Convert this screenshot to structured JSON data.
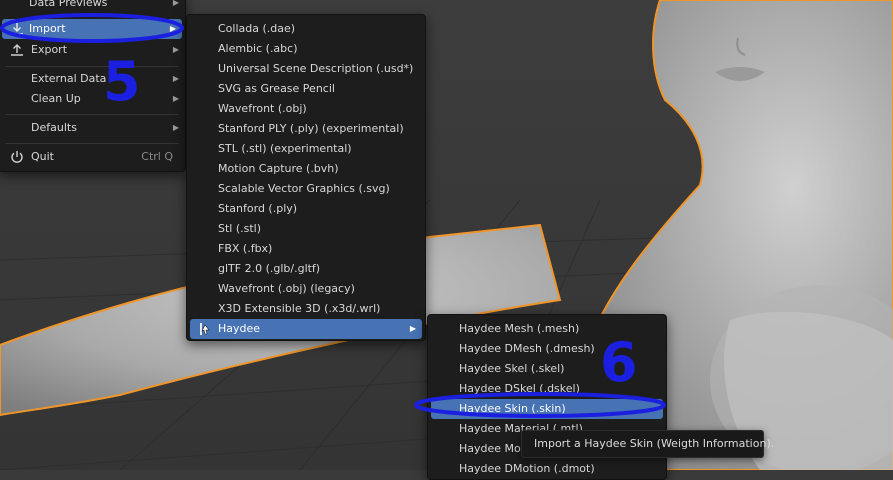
{
  "file_menu": {
    "items": [
      {
        "label": "Data Previews",
        "icon": "",
        "arrow": true
      },
      {
        "label": "Import",
        "icon": "import-icon",
        "arrow": true,
        "highlighted": true
      },
      {
        "label": "Export",
        "icon": "export-icon",
        "arrow": true
      },
      {
        "label": "External Data",
        "icon": "",
        "arrow": true
      },
      {
        "label": "Clean Up",
        "icon": "",
        "arrow": true
      },
      {
        "label": "Defaults",
        "icon": "",
        "arrow": true
      },
      {
        "label": "Quit",
        "icon": "power-icon",
        "shortcut": "Ctrl Q"
      }
    ]
  },
  "import_menu": {
    "items": [
      {
        "label": "Collada (.dae)"
      },
      {
        "label": "Alembic (.abc)"
      },
      {
        "label": "Universal Scene Description (.usd*)"
      },
      {
        "label": "SVG as Grease Pencil"
      },
      {
        "label": "Wavefront (.obj)"
      },
      {
        "label": "Stanford PLY (.ply) (experimental)"
      },
      {
        "label": "STL (.stl) (experimental)"
      },
      {
        "label": "Motion Capture (.bvh)"
      },
      {
        "label": "Scalable Vector Graphics (.svg)"
      },
      {
        "label": "Stanford (.ply)"
      },
      {
        "label": "Stl (.stl)"
      },
      {
        "label": "FBX (.fbx)"
      },
      {
        "label": "glTF 2.0 (.glb/.gltf)"
      },
      {
        "label": "Wavefront (.obj) (legacy)"
      },
      {
        "label": "X3D Extensible 3D (.x3d/.wrl)"
      },
      {
        "label": "Haydee",
        "highlighted": true,
        "arrow": true,
        "icon": "haydee-icon"
      }
    ]
  },
  "haydee_menu": {
    "items": [
      {
        "label": "Haydee Mesh (.mesh)"
      },
      {
        "label": "Haydee DMesh (.dmesh)"
      },
      {
        "label": "Haydee Skel (.skel)"
      },
      {
        "label": "Haydee DSkel (.dskel)"
      },
      {
        "label": "Haydee Skin (.skin)",
        "highlighted": true
      },
      {
        "label": "Haydee Material (.mtl)"
      },
      {
        "label": "Haydee Motion (.motion)"
      },
      {
        "label": "Haydee DMotion (.dmot)"
      }
    ]
  },
  "tooltip": {
    "text": "Import a Haydee Skin (Weigth Information)."
  },
  "annotations": {
    "step_5": "5",
    "step_6": "6",
    "color": "#1b20e0"
  },
  "colors": {
    "highlight": "#4772b3",
    "menu_bg": "#1d1d1d",
    "selection_outline": "#f0952a",
    "viewport_bg": "#3a3a3a"
  }
}
